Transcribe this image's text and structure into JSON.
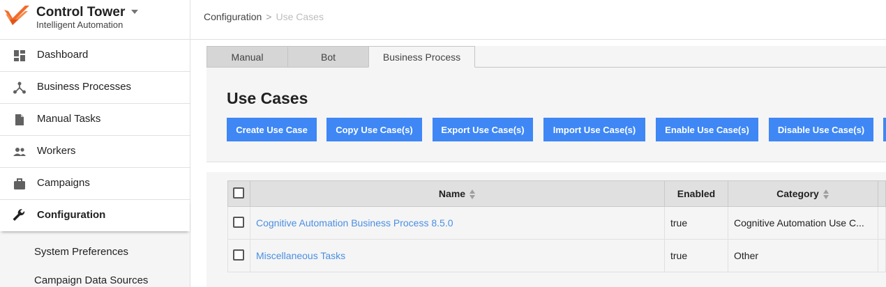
{
  "app": {
    "title": "Control Tower",
    "subtitle": "Intelligent Automation",
    "brand_color": "#f26b2a"
  },
  "sidebar": {
    "items": [
      {
        "label": "Dashboard",
        "icon": "dashboard-icon"
      },
      {
        "label": "Business Processes",
        "icon": "hierarchy-icon"
      },
      {
        "label": "Manual Tasks",
        "icon": "document-icon"
      },
      {
        "label": "Workers",
        "icon": "people-icon"
      },
      {
        "label": "Campaigns",
        "icon": "briefcase-icon"
      },
      {
        "label": "Configuration",
        "icon": "wrench-icon",
        "active": true
      }
    ],
    "sub_items": [
      {
        "label": "System Preferences"
      },
      {
        "label": "Campaign Data Sources"
      }
    ]
  },
  "breadcrumb": {
    "parent": "Configuration",
    "separator": ">",
    "current": "Use Cases"
  },
  "tabs": [
    {
      "label": "Manual"
    },
    {
      "label": "Bot"
    },
    {
      "label": "Business Process",
      "active": true
    }
  ],
  "page": {
    "heading": "Use Cases"
  },
  "actions": [
    {
      "label": "Create Use Case"
    },
    {
      "label": "Copy Use Case(s)"
    },
    {
      "label": "Export Use Case(s)"
    },
    {
      "label": "Import Use Case(s)"
    },
    {
      "label": "Enable Use Case(s)"
    },
    {
      "label": "Disable Use Case(s)"
    }
  ],
  "accent_color": "#3e87f5",
  "table": {
    "columns": [
      "Name",
      "Enabled",
      "Category"
    ],
    "rows": [
      {
        "name": "Cognitive Automation Business Process 8.5.0",
        "enabled": "true",
        "category": "Cognitive Automation Use C..."
      },
      {
        "name": "Miscellaneous Tasks",
        "enabled": "true",
        "category": "Other"
      }
    ]
  }
}
